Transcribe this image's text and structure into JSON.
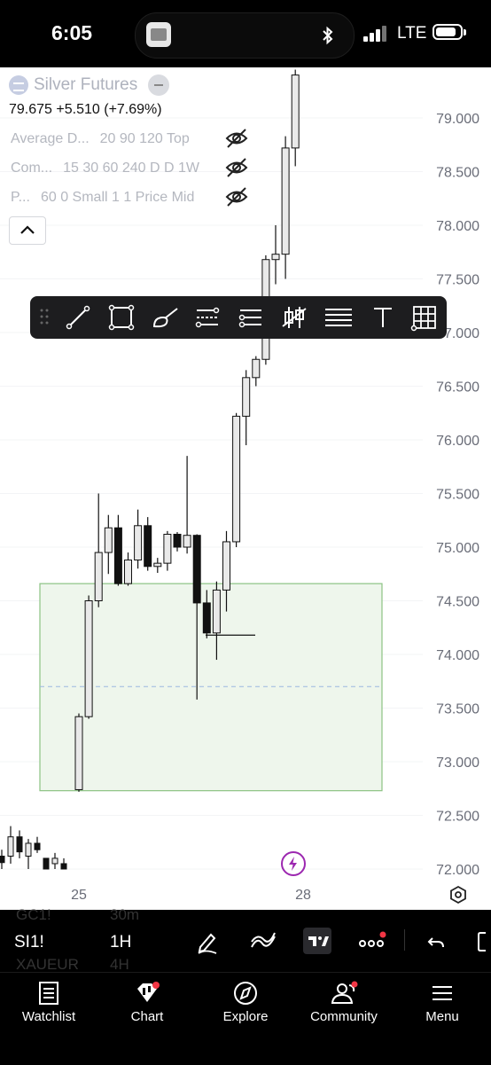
{
  "status_bar": {
    "time": "6:05",
    "network": "LTE"
  },
  "symbol": {
    "name": "Silver Futures",
    "price": "79.675",
    "change": "+5.510",
    "change_pct": "(+7.69%)"
  },
  "indicators": [
    {
      "name": "Average D...",
      "args": "20 90 120 Top"
    },
    {
      "name": "Com...",
      "args": "15 30 60 240 D D 1W"
    },
    {
      "name": "P...",
      "args": "60 0 Small 1 1 Price Mid"
    }
  ],
  "chart_data": {
    "type": "candlestick",
    "price_axis": [
      "79.000",
      "78.500",
      "78.000",
      "77.500",
      "77.000",
      "76.500",
      "76.000",
      "75.500",
      "75.000",
      "74.500",
      "74.000",
      "73.500",
      "73.000",
      "72.500",
      "72.000"
    ],
    "time_axis": [
      "25",
      "28"
    ],
    "candles": [
      {
        "o": 72.74,
        "h": 73.45,
        "l": 72.72,
        "c": 73.42
      },
      {
        "o": 73.42,
        "h": 74.55,
        "l": 73.4,
        "c": 74.5
      },
      {
        "o": 74.5,
        "h": 75.5,
        "l": 74.44,
        "c": 74.95
      },
      {
        "o": 74.95,
        "h": 75.3,
        "l": 74.75,
        "c": 75.18
      },
      {
        "o": 75.18,
        "h": 75.3,
        "l": 74.64,
        "c": 74.66
      },
      {
        "o": 74.66,
        "h": 74.95,
        "l": 74.64,
        "c": 74.88
      },
      {
        "o": 74.88,
        "h": 75.35,
        "l": 74.8,
        "c": 75.2
      },
      {
        "o": 75.2,
        "h": 75.28,
        "l": 74.78,
        "c": 74.82
      },
      {
        "o": 74.82,
        "h": 74.9,
        "l": 74.76,
        "c": 74.85
      },
      {
        "o": 74.85,
        "h": 75.15,
        "l": 74.78,
        "c": 75.12
      },
      {
        "o": 75.12,
        "h": 75.14,
        "l": 74.96,
        "c": 75.0
      },
      {
        "o": 75.0,
        "h": 75.85,
        "l": 74.94,
        "c": 75.11
      },
      {
        "o": 75.11,
        "h": 75.12,
        "l": 73.58,
        "c": 74.48
      },
      {
        "o": 74.48,
        "h": 74.6,
        "l": 74.15,
        "c": 74.2
      },
      {
        "o": 74.2,
        "h": 74.68,
        "l": 73.95,
        "c": 74.6
      },
      {
        "o": 74.6,
        "h": 75.15,
        "l": 74.4,
        "c": 75.05
      },
      {
        "o": 75.05,
        "h": 76.25,
        "l": 75.0,
        "c": 76.22
      },
      {
        "o": 76.22,
        "h": 76.65,
        "l": 75.95,
        "c": 76.58
      },
      {
        "o": 76.58,
        "h": 76.78,
        "l": 76.5,
        "c": 76.75
      },
      {
        "o": 76.75,
        "h": 77.72,
        "l": 76.7,
        "c": 77.68
      },
      {
        "o": 77.68,
        "h": 78.0,
        "l": 77.45,
        "c": 77.73
      },
      {
        "o": 77.73,
        "h": 78.83,
        "l": 77.5,
        "c": 78.72
      },
      {
        "o": 78.72,
        "h": 79.45,
        "l": 78.55,
        "c": 79.4
      }
    ],
    "prior_candles": [
      {
        "o": 72.12,
        "h": 72.18,
        "l": 72.0,
        "c": 72.06
      },
      {
        "o": 72.12,
        "h": 72.4,
        "l": 72.05,
        "c": 72.3
      },
      {
        "o": 72.3,
        "h": 72.36,
        "l": 72.1,
        "c": 72.16
      },
      {
        "o": 72.12,
        "h": 72.28,
        "l": 72.0,
        "c": 72.24
      },
      {
        "o": 72.24,
        "h": 72.3,
        "l": 72.15,
        "c": 72.18
      },
      {
        "o": 72.1,
        "h": 72.05,
        "l": 72.0,
        "c": 72.0
      },
      {
        "o": 72.05,
        "h": 72.15,
        "l": 72.0,
        "c": 72.1
      },
      {
        "o": 72.05,
        "h": 72.1,
        "l": 72.0,
        "c": 72.0
      }
    ],
    "zone": {
      "top": 74.66,
      "bottom": 72.73,
      "mid": 73.7,
      "color": "#a5d6a7"
    },
    "horizontal_line": 74.18
  },
  "drawing_toolbar": {
    "tools": [
      "drag-handle-icon",
      "trend-line-icon",
      "rectangle-icon",
      "brush-icon",
      "fib-retracement-icon",
      "horizontal-rays-icon",
      "long-position-icon",
      "parallel-lines-icon",
      "text-tool-icon",
      "grid-icon"
    ]
  },
  "bottom_toolbar": {
    "symbol": "SI1!",
    "interval": "1H",
    "ghost_symbols": [
      "GC1!",
      "XAUEUR"
    ],
    "ghost_intervals": [
      "30m",
      "4H"
    ]
  },
  "tab_bar": {
    "watchlist": "Watchlist",
    "chart": "Chart",
    "explore": "Explore",
    "community": "Community",
    "menu": "Menu"
  },
  "colors": {
    "zone_fill": "#eef6ec",
    "zone_border": "#8bc383",
    "accent_red": "#f23645",
    "alert_purple": "#9c27b0"
  }
}
